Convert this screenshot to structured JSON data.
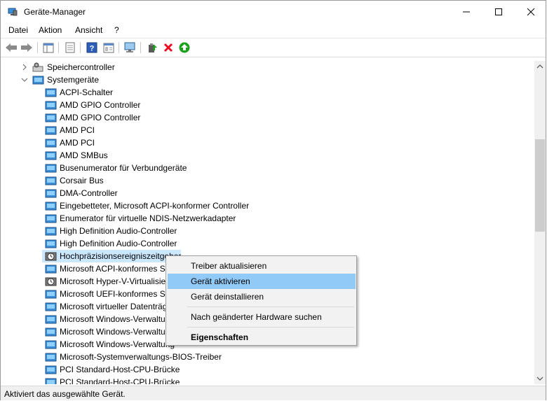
{
  "window": {
    "title": "Geräte-Manager"
  },
  "menu": [
    "Datei",
    "Aktion",
    "Ansicht",
    "?"
  ],
  "tree": {
    "categories": [
      {
        "label": "Speichercontroller",
        "expanded": false
      },
      {
        "label": "Systemgeräte",
        "expanded": true
      }
    ],
    "devices": [
      "ACPI-Schalter",
      "AMD GPIO Controller",
      "AMD GPIO Controller",
      "AMD PCI",
      "AMD PCI",
      "AMD SMBus",
      "Busenumerator für Verbundgeräte",
      "Corsair Bus",
      "DMA-Controller",
      "Eingebetteter, Microsoft ACPI-konformer Controller",
      "Enumerator für virtuelle NDIS-Netzwerkadapter",
      "High Definition Audio-Controller",
      "High Definition Audio-Controller",
      "Hochpräzisionsereigniszeitgeber",
      "Microsoft ACPI-konformes S",
      "Microsoft Hyper-V-Virtualisie",
      "Microsoft UEFI-konformes Sy",
      "Microsoft virtueller Datenträg",
      "Microsoft Windows-Verwaltu",
      "Microsoft Windows-Verwaltu",
      "Microsoft Windows-Verwaltung",
      "Microsoft-Systemverwaltungs-BIOS-Treiber",
      "PCI Standard-Host-CPU-Brücke",
      "PCI Standard-Host-CPU-Brücke"
    ]
  },
  "context_menu": {
    "items": [
      {
        "label": "Treiber aktualisieren"
      },
      {
        "label": "Gerät aktivieren",
        "highlighted": true
      },
      {
        "label": "Gerät deinstallieren"
      },
      {
        "label": "Nach geänderter Hardware suchen"
      },
      {
        "label": "Eigenschaften",
        "bold": true
      }
    ]
  },
  "status": {
    "text": "Aktiviert das ausgewählte Gerät."
  },
  "colors": {
    "highlight": "#91c9f7",
    "selection": "#cce8ff",
    "delete_red": "#e81123",
    "update_green": "#1ba11b"
  }
}
